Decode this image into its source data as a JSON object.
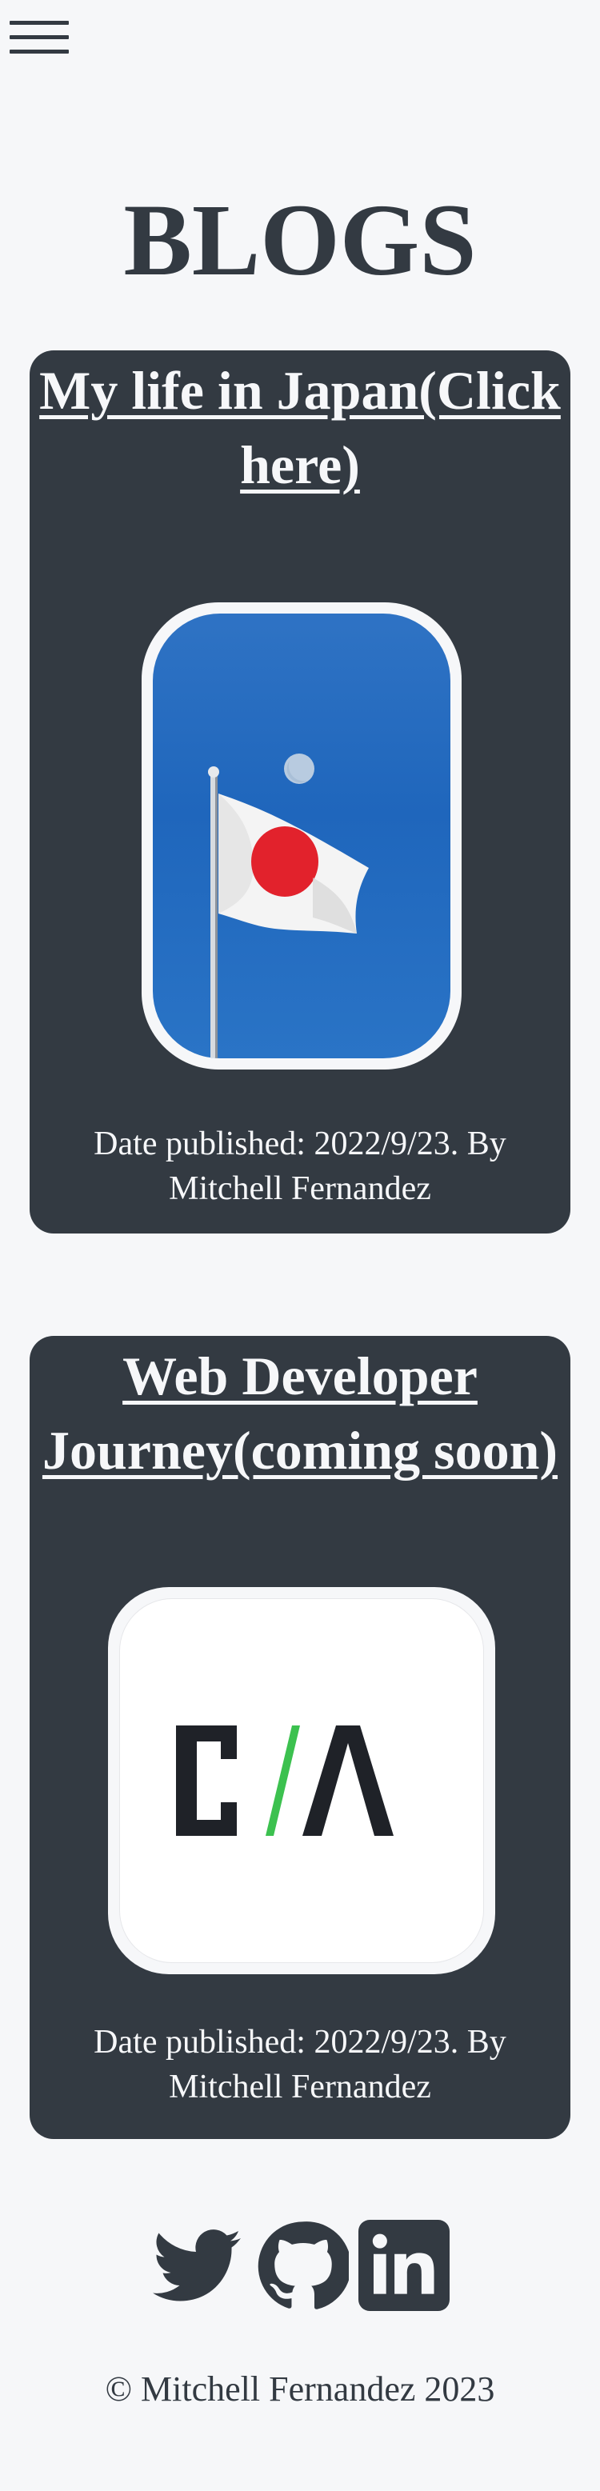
{
  "header": {
    "menu_icon": "hamburger-icon"
  },
  "page": {
    "title": "BLOGS"
  },
  "posts": [
    {
      "title": "My life in Japan(Click here)",
      "image": "japan-flag-image",
      "meta": "Date published: 2022/9/23. By Mitchell Fernandez"
    },
    {
      "title": "Web Developer Journey(coming soon)",
      "image": "ca-logo-image",
      "meta": "Date published: 2022/9/23. By Mitchell Fernandez"
    }
  ],
  "footer": {
    "social_icons": [
      "twitter-icon",
      "github-icon",
      "linkedin-icon"
    ],
    "copyright": "© Mitchell Fernandez 2023"
  },
  "colors": {
    "background": "#f6f7f9",
    "card": "#333a42",
    "text_dark": "#333a42",
    "text_light": "#f6f7f9",
    "accent_green": "#3cc14f"
  }
}
